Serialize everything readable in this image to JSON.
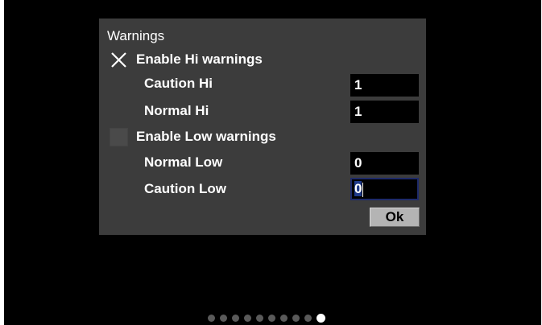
{
  "dialog": {
    "title": "Warnings",
    "hi": {
      "checkbox_label": "Enable Hi warnings",
      "checked": true,
      "caution_label": "Caution Hi",
      "caution_value": "1",
      "normal_label": "Normal Hi",
      "normal_value": "1"
    },
    "low": {
      "checkbox_label": "Enable Low warnings",
      "checked": false,
      "normal_label": "Normal Low",
      "normal_value": "0",
      "caution_label": "Caution Low",
      "caution_value": "0"
    },
    "ok_label": "Ok"
  },
  "pager": {
    "total": 10,
    "active_index": 9
  },
  "colors": {
    "background": "#000000",
    "dialog": "#3c3c3c",
    "field": "#000000",
    "focus_selection": "#1f3a8a",
    "button": "#b4b4b4"
  }
}
